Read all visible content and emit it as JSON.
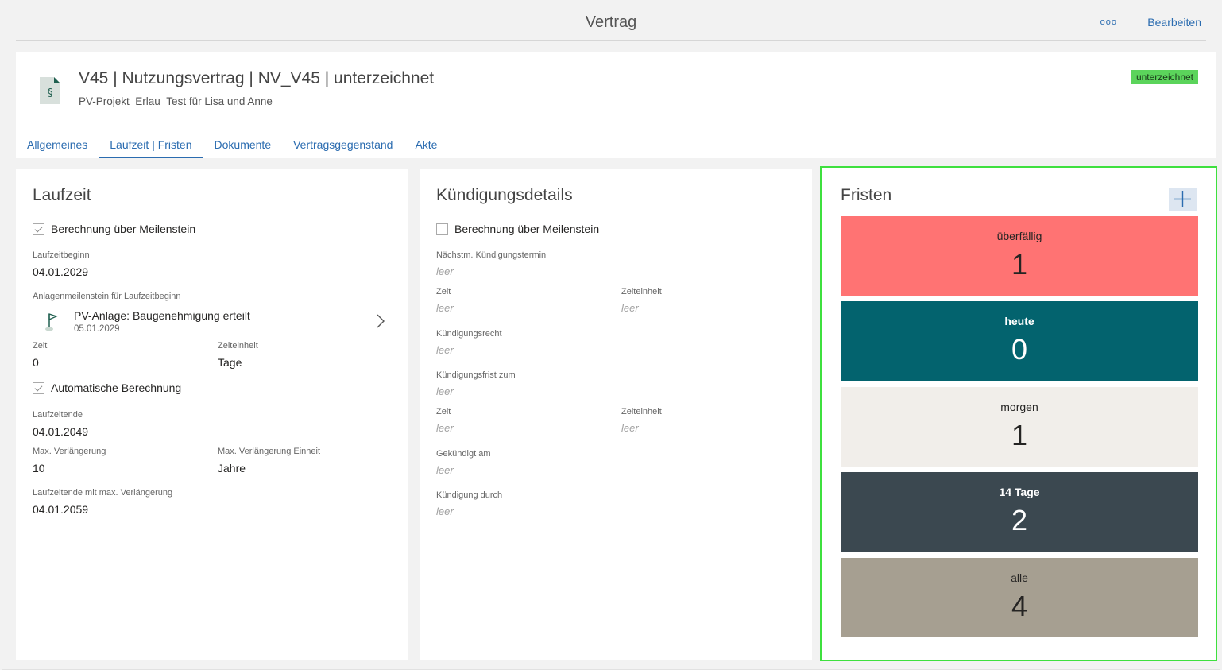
{
  "window": {
    "title": "Vertrag",
    "more_label": "ooo",
    "edit_label": "Bearbeiten"
  },
  "contract": {
    "title": "V45 | Nutzungsvertrag | NV_V45 | unterzeichnet",
    "subtitle": "PV-Projekt_Erlau_Test für Lisa und Anne",
    "status": "unterzeichnet",
    "icon": "contract-document-icon"
  },
  "tabs": [
    {
      "label": "Allgemeines"
    },
    {
      "label": "Laufzeit | Fristen",
      "active": true
    },
    {
      "label": "Dokumente"
    },
    {
      "label": "Vertragsgegenstand"
    },
    {
      "label": "Akte"
    }
  ],
  "laufzeit": {
    "title": "Laufzeit",
    "berechnung_meilenstein": {
      "label": "Berechnung über Meilenstein",
      "checked": true
    },
    "beginn": {
      "label": "Laufzeitbeginn",
      "value": "04.01.2029"
    },
    "meilenstein": {
      "label": "Anlagenmeilenstein für Laufzeitbeginn",
      "name": "PV-Anlage: Baugenehmigung erteilt",
      "date": "05.01.2029",
      "icon": "flag-icon"
    },
    "zeit": {
      "label": "Zeit",
      "value": "0"
    },
    "zeiteinheit": {
      "label": "Zeiteinheit",
      "value": "Tage"
    },
    "auto_berechnung": {
      "label": "Automatische Berechnung",
      "checked": true
    },
    "ende": {
      "label": "Laufzeitende",
      "value": "04.01.2049"
    },
    "max_verl": {
      "label": "Max. Verlängerung",
      "value": "10"
    },
    "max_verl_einheit": {
      "label": "Max. Verlängerung Einheit",
      "value": "Jahre"
    },
    "ende_max": {
      "label": "Laufzeitende mit max. Verlängerung",
      "value": "04.01.2059"
    }
  },
  "kuendigung": {
    "title": "Kündigungsdetails",
    "berechnung_meilenstein": {
      "label": "Berechnung über Meilenstein",
      "checked": false
    },
    "empty_text": "leer",
    "naechstm": {
      "label": "Nächstm. Kündigungstermin"
    },
    "zeit1": {
      "label": "Zeit"
    },
    "zeiteinheit1": {
      "label": "Zeiteinheit"
    },
    "recht": {
      "label": "Kündigungsrecht"
    },
    "frist_zum": {
      "label": "Kündigungsfrist zum"
    },
    "zeit2": {
      "label": "Zeit"
    },
    "zeiteinheit2": {
      "label": "Zeiteinheit"
    },
    "gekuendigt_am": {
      "label": "Gekündigt am"
    },
    "durch": {
      "label": "Kündigung durch"
    }
  },
  "fristen": {
    "title": "Fristen",
    "add_icon": "plus-icon",
    "tiles": [
      {
        "label": "überfällig",
        "count": "1",
        "bg": "#ff7373",
        "fg": "#252423"
      },
      {
        "label": "heute",
        "count": "0",
        "bg": "#03636e",
        "fg": "#ffffff"
      },
      {
        "label": "morgen",
        "count": "1",
        "bg": "#f1eeea",
        "fg": "#252423"
      },
      {
        "label": "14 Tage",
        "count": "2",
        "bg": "#3b4850",
        "fg": "#ffffff"
      },
      {
        "label": "alle",
        "count": "4",
        "bg": "#a69f91",
        "fg": "#252423"
      }
    ]
  }
}
